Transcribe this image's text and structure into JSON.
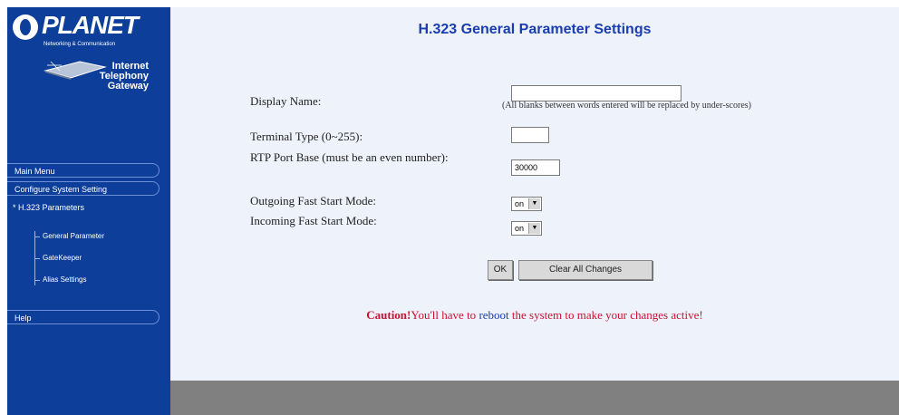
{
  "sidebar": {
    "logo_text": "PLANET",
    "logo_subtitle": "Networking & Communication",
    "product_lines": [
      "Internet",
      "Telephony",
      "Gateway"
    ],
    "menu": [
      {
        "label": "Main Menu"
      },
      {
        "label": "Configure System Setting"
      }
    ],
    "section_label": "* H.323 Parameters",
    "sub_items": [
      {
        "label": "General Parameter"
      },
      {
        "label": "GateKeeper"
      },
      {
        "label": "Alias Settings"
      }
    ],
    "help_label": "Help"
  },
  "main": {
    "title": "H.323 General Parameter Settings",
    "fields": {
      "display_name": {
        "label": "Display Name:",
        "value": ""
      },
      "display_hint": "(All blanks between words entered will be replaced by under-scores)",
      "terminal_type": {
        "label": "Terminal Type (0~255):",
        "value": ""
      },
      "rtp_port": {
        "label": "RTP Port Base (must be an even number):",
        "value": "30000"
      },
      "outgoing_fast_start": {
        "label": "Outgoing Fast Start Mode:",
        "value": "on"
      },
      "incoming_fast_start": {
        "label": "Incoming Fast Start Mode:",
        "value": "on"
      }
    },
    "buttons": {
      "ok": "OK",
      "clear": "Clear All Changes"
    },
    "caution": {
      "prefix": "Caution!",
      "before_link": "You'll have to ",
      "link": "reboot",
      "after_link": " the system to make your changes active!"
    }
  },
  "colors": {
    "sidebar": "#0d3f9a",
    "title": "#1a3eb0",
    "caution": "#cc1133",
    "footer": "#808080"
  }
}
